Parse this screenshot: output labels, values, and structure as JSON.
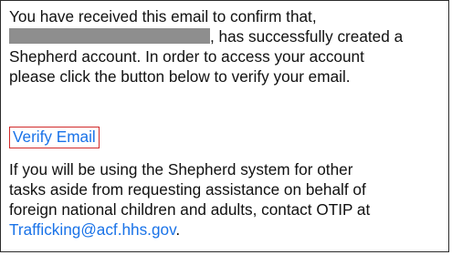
{
  "email": {
    "intro_line_1": "You have received this email to confirm that,",
    "intro_line_2_suffix": ", has successfully created a",
    "intro_line_3": "Shepherd account. In order to access your account",
    "intro_line_4": "please click the button below to verify your email.",
    "verify_label": "Verify Email",
    "note_line_1": "If you will be using the Shepherd system for other",
    "note_line_2": "tasks aside from requesting assistance on behalf of",
    "note_line_3": "foreign national children and adults, contact OTIP at",
    "contact_email": "Trafficking@acf.hhs.gov",
    "closing_punctuation": "."
  },
  "colors": {
    "link": "#1a73e8",
    "highlight_border": "#d12a2a",
    "redaction": "#8e8e8e"
  }
}
